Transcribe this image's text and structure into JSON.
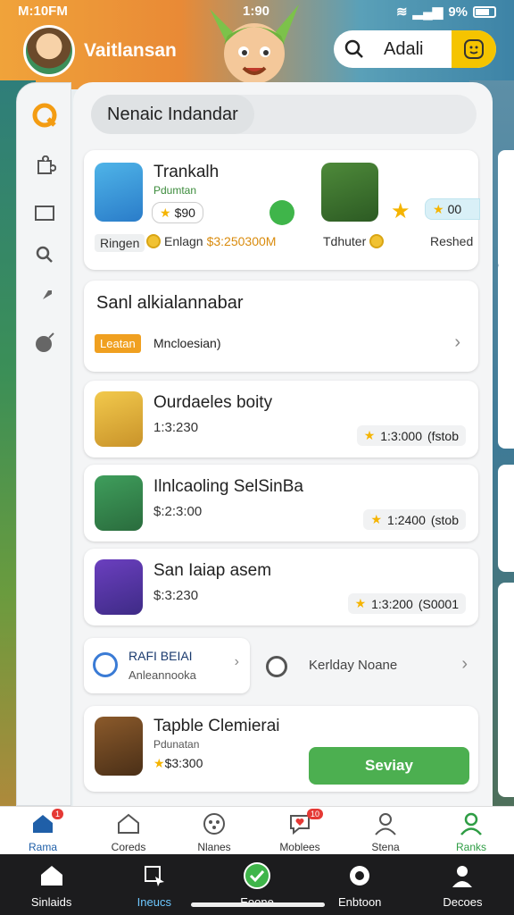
{
  "status": {
    "time": "M:10FM",
    "clock": "1:90",
    "battery": "9%"
  },
  "header": {
    "username": "Vaitlansan",
    "search_label": "Adali"
  },
  "page_title": "Nenaic Indandar",
  "featured": {
    "name": "Trankalh",
    "subtitle": "Pdumtan",
    "price": "$90",
    "second_price": "00",
    "meta_tag": "Ringen",
    "meta_label": "Enlagn",
    "meta_amount": "$3:250300M",
    "second_label": "Tdhuter",
    "third_label": "Reshed"
  },
  "section": {
    "title": "Sanl alkialannabar",
    "badge": "Leatan",
    "desc": "Mncloesian)"
  },
  "rows": [
    {
      "name": "Ourdaeles boity",
      "price": "1:3:230",
      "rating": "1:3:000",
      "extra": "(fstob"
    },
    {
      "name": "Ilnlcaoling SelSinBa",
      "price": "$:2:3:00",
      "rating": "1:2400",
      "extra": "(stob"
    },
    {
      "name": "San Iaiap asem",
      "price": "$:3:230",
      "rating": "1:3:200",
      "extra": "(S0001"
    }
  ],
  "mini_left": {
    "title": "RAFI BEIAI",
    "subtitle": "Anleannooka"
  },
  "mini_right": {
    "title": "Kerlday Noane"
  },
  "last": {
    "name": "Tapble Clemierai",
    "subtitle": "Pdunatan",
    "price": "$3:300",
    "action": "Seviay"
  },
  "tabs": [
    {
      "label": "Rama",
      "icon": "home-icon",
      "badge": "1"
    },
    {
      "label": "Coreds",
      "icon": "house-outline-icon",
      "badge": ""
    },
    {
      "label": "Nlanes",
      "icon": "gamepad-icon",
      "badge": ""
    },
    {
      "label": "Moblees",
      "icon": "heart-chat-icon",
      "badge": "10"
    },
    {
      "label": "Stena",
      "icon": "person-icon",
      "badge": ""
    },
    {
      "label": "Ranks",
      "icon": "person-green-icon",
      "badge": ""
    }
  ],
  "sysnav": [
    {
      "label": "Sinlaids",
      "icon": "home-icon"
    },
    {
      "label": "Ineucs",
      "icon": "cursor-icon"
    },
    {
      "label": "Eoone",
      "icon": "check-circle-icon"
    },
    {
      "label": "Enbtoon",
      "icon": "eye-icon"
    },
    {
      "label": "Decoes",
      "icon": "person-icon"
    }
  ],
  "colors": {
    "accent_green": "#4caf50",
    "accent_yellow": "#f5c400",
    "badge_orange": "#f0a020",
    "badge_red": "#e53935"
  }
}
